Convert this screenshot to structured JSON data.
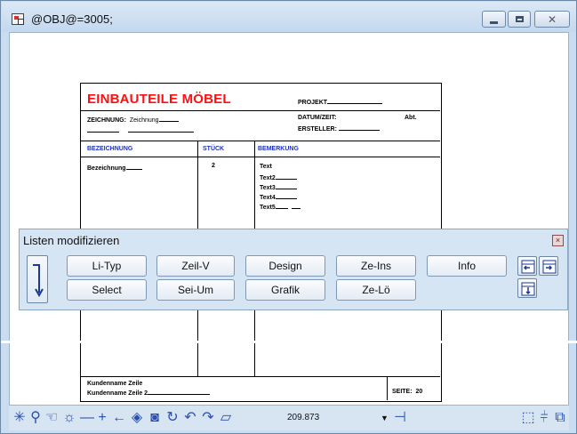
{
  "window": {
    "title": "@OBJ@=3005;",
    "close_glyph": "✕"
  },
  "sheet": {
    "title": "EINBAUTEILE MÖBEL",
    "projekt_label": "PROJEKT",
    "zeichnung_label": "ZEICHNUNG:",
    "zeichnung_value": "Zeichnung",
    "datum_label": "DATUM/ZEIT:",
    "abt_label": "Abt.",
    "ersteller_label": "ERSTELLER:",
    "columns": [
      "BEZEICHNUNG",
      "STÜCK",
      "BEMERKUNG"
    ],
    "row_bezeichnung": "Bezeichnung",
    "row_stueck": "2",
    "row_texts": [
      "Text",
      "Text2",
      "Text3",
      "Text4",
      "Text5"
    ],
    "footer_line1": "Kundenname Zeile",
    "footer_line2": "Kundenname Zeile 2",
    "seite_label": "SEITE:",
    "seite_value": "20"
  },
  "panel": {
    "title": "Listen modifizieren",
    "close_glyph": "×",
    "buttons": {
      "li_typ": "Li-Typ",
      "zeil_v": "Zeil-V",
      "design": "Design",
      "ze_ins": "Ze-Ins",
      "info": "Info",
      "select": "Select",
      "sei_um": "Sei-Um",
      "grafik": "Grafik",
      "ze_loe": "Ze-Lö"
    }
  },
  "toolbar": {
    "zoom_value": "209.873",
    "icons": [
      "snap-star-icon",
      "zoom-icon",
      "pan-hand-icon",
      "sun-icon",
      "line-icon",
      "cross-icon",
      "arrow-left-icon",
      "fill-icon",
      "camera-icon",
      "rotate-icon",
      "undo-icon",
      "redo-icon",
      "folder-icon",
      "dropdown-icon",
      "pin-icon",
      "cube-icon",
      "split-icon",
      "copy-icon"
    ],
    "accent": "#2a4fb0"
  }
}
